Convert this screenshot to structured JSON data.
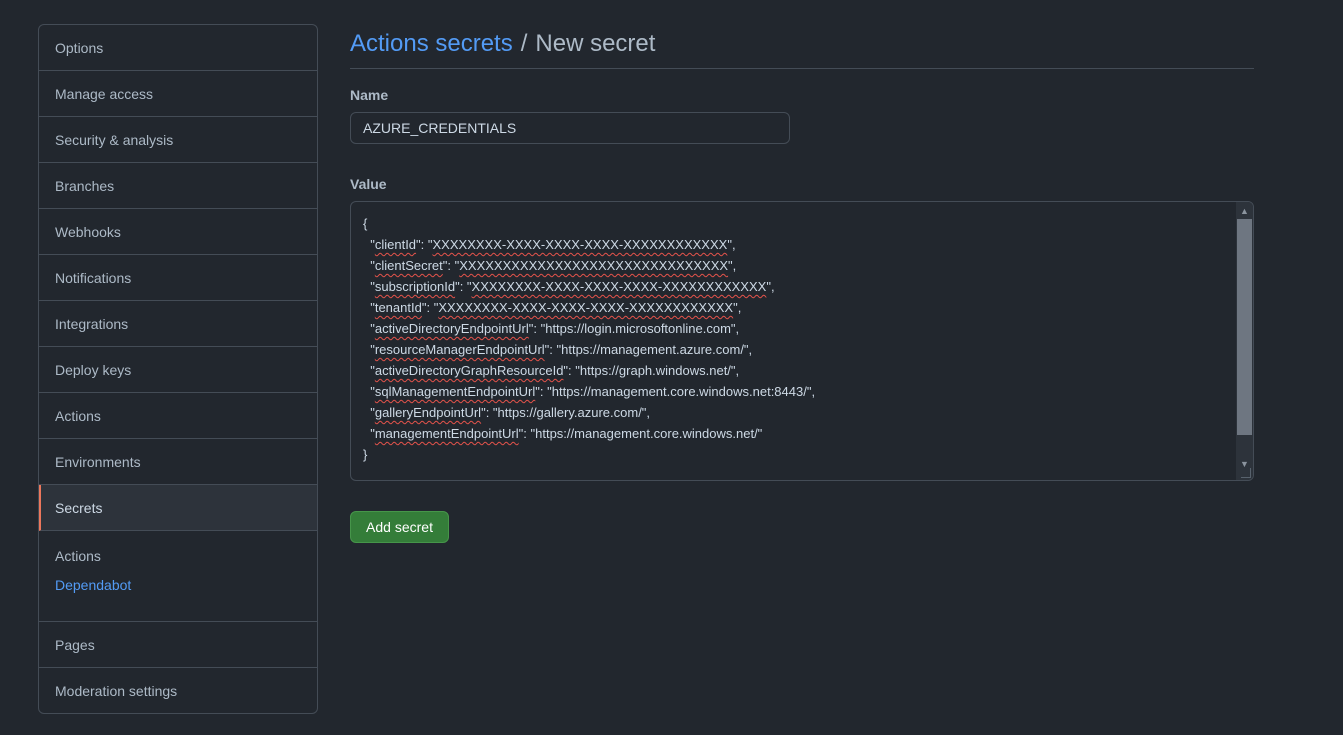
{
  "sidebar": {
    "items_top": [
      "Options",
      "Manage access",
      "Security & analysis",
      "Branches",
      "Webhooks",
      "Notifications",
      "Integrations",
      "Deploy keys",
      "Actions",
      "Environments"
    ],
    "selected": "Secrets",
    "sub_items": [
      "Actions",
      "Dependabot"
    ],
    "items_bottom": [
      "Pages",
      "Moderation settings"
    ]
  },
  "header": {
    "breadcrumb": "Actions secrets",
    "separator": "/",
    "title": "New secret"
  },
  "form": {
    "name_label": "Name",
    "name_value": "AZURE_CREDENTIALS",
    "value_label": "Value",
    "value_lines": [
      "{",
      "  \"clientId\": \"XXXXXXXX-XXXX-XXXX-XXXX-XXXXXXXXXXXX\",",
      "  \"clientSecret\": \"XXXXXXXXXXXXXXXXXXXXXXXXXXXXXXX\",",
      "  \"subscriptionId\": \"XXXXXXXX-XXXX-XXXX-XXXX-XXXXXXXXXXXX\",",
      "  \"tenantId\": \"XXXXXXXX-XXXX-XXXX-XXXX-XXXXXXXXXXXX\",",
      "  \"activeDirectoryEndpointUrl\": \"https://login.microsoftonline.com\",",
      "  \"resourceManagerEndpointUrl\": \"https://management.azure.com/\",",
      "  \"activeDirectoryGraphResourceId\": \"https://graph.windows.net/\",",
      "  \"sqlManagementEndpointUrl\": \"https://management.core.windows.net:8443/\",",
      "  \"galleryEndpointUrl\": \"https://gallery.azure.com/\",",
      "  \"managementEndpointUrl\": \"https://management.core.windows.net/\"",
      "}"
    ],
    "submit_label": "Add secret"
  },
  "colors": {
    "link": "#539bf5",
    "selected_accent": "#ec775c",
    "button": "#347d39"
  }
}
